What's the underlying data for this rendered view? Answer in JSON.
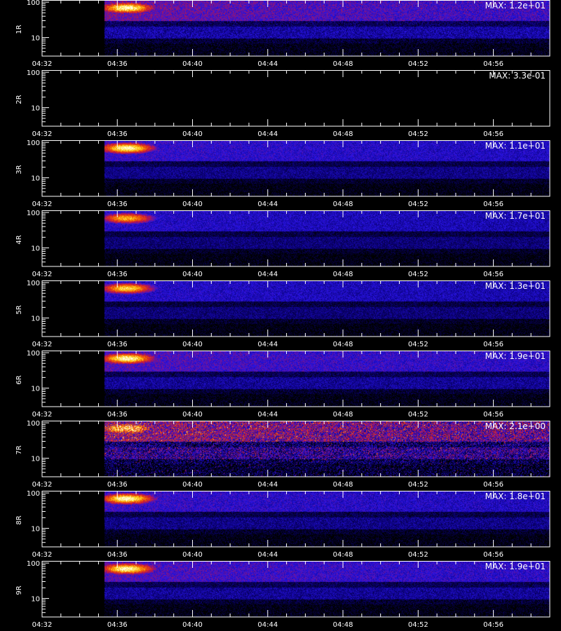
{
  "chart_data": [
    {
      "type": "heatmap",
      "channel": "1R",
      "max_label": "MAX: 1.2e+01",
      "max": 12.0,
      "peak_level": 1.0,
      "band_level": 0.55,
      "noise": 0.25,
      "x_ticks": [
        "04:32",
        "04:36",
        "04:40",
        "04:44",
        "04:48",
        "04:52",
        "04:56"
      ],
      "y_ticks": [
        "100",
        "10"
      ],
      "yscale": "log"
    },
    {
      "type": "heatmap",
      "channel": "2R",
      "max_label": "MAX: 3.3e-01",
      "max": 0.33,
      "peak_level": 0.0,
      "band_level": 0.0,
      "noise": 0.0,
      "x_ticks": [
        "04:32",
        "04:36",
        "04:40",
        "04:44",
        "04:48",
        "04:52",
        "04:56"
      ],
      "y_ticks": [
        "100",
        "10"
      ],
      "yscale": "log"
    },
    {
      "type": "heatmap",
      "channel": "3R",
      "max_label": "MAX: 1.1e+01",
      "max": 11.0,
      "peak_level": 1.0,
      "band_level": 0.45,
      "noise": 0.2,
      "x_ticks": [
        "04:32",
        "04:36",
        "04:40",
        "04:44",
        "04:48",
        "04:52",
        "04:56"
      ],
      "y_ticks": [
        "100",
        "10"
      ],
      "yscale": "log"
    },
    {
      "type": "heatmap",
      "channel": "4R",
      "max_label": "MAX: 1.7e+01",
      "max": 17.0,
      "peak_level": 0.85,
      "band_level": 0.4,
      "noise": 0.2,
      "x_ticks": [
        "04:32",
        "04:36",
        "04:40",
        "04:44",
        "04:48",
        "04:52",
        "04:56"
      ],
      "y_ticks": [
        "100",
        "10"
      ],
      "yscale": "log"
    },
    {
      "type": "heatmap",
      "channel": "5R",
      "max_label": "MAX: 1.3e+01",
      "max": 13.0,
      "peak_level": 0.9,
      "band_level": 0.4,
      "noise": 0.2,
      "x_ticks": [
        "04:32",
        "04:36",
        "04:40",
        "04:44",
        "04:48",
        "04:52",
        "04:56"
      ],
      "y_ticks": [
        "100",
        "10"
      ],
      "yscale": "log"
    },
    {
      "type": "heatmap",
      "channel": "6R",
      "max_label": "MAX: 1.9e+01",
      "max": 19.0,
      "peak_level": 1.0,
      "band_level": 0.5,
      "noise": 0.22,
      "x_ticks": [
        "04:32",
        "04:36",
        "04:40",
        "04:44",
        "04:48",
        "04:52",
        "04:56"
      ],
      "y_ticks": [
        "100",
        "10"
      ],
      "yscale": "log"
    },
    {
      "type": "heatmap",
      "channel": "7R",
      "max_label": "MAX: 2.1e+00",
      "max": 2.1,
      "peak_level": 0.9,
      "band_level": 0.6,
      "noise": 0.55,
      "x_ticks": [
        "04:32",
        "04:36",
        "04:40",
        "04:44",
        "04:48",
        "04:52",
        "04:56"
      ],
      "y_ticks": [
        "100",
        "10"
      ],
      "yscale": "log"
    },
    {
      "type": "heatmap",
      "channel": "8R",
      "max_label": "MAX: 1.8e+01",
      "max": 18.0,
      "peak_level": 1.0,
      "band_level": 0.45,
      "noise": 0.22,
      "x_ticks": [
        "04:32",
        "04:36",
        "04:40",
        "04:44",
        "04:48",
        "04:52",
        "04:56"
      ],
      "y_ticks": [
        "100",
        "10"
      ],
      "yscale": "log"
    },
    {
      "type": "heatmap",
      "channel": "9R",
      "max_label": "MAX: 1.9e+01",
      "max": 19.0,
      "peak_level": 1.0,
      "band_level": 0.5,
      "noise": 0.22,
      "x_ticks": [
        "04:32",
        "04:36",
        "04:40",
        "04:44",
        "04:48",
        "04:52",
        "04:56"
      ],
      "y_ticks": [
        "100",
        "10"
      ],
      "yscale": "log"
    }
  ],
  "colors": {
    "background": "#000000",
    "axes": "#ffffff"
  }
}
